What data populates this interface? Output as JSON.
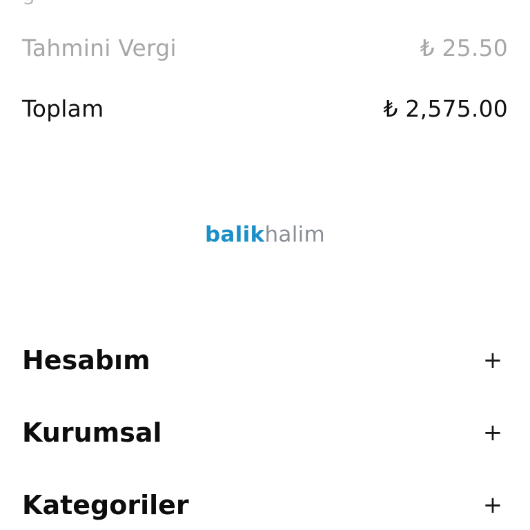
{
  "summary": {
    "tax_label": "Tahmini Vergi",
    "tax_value": "₺ 25.50",
    "total_label": "Toplam",
    "total_value": "₺ 2,575.00"
  },
  "brand": {
    "logo_part1": "balik",
    "logo_part2": "halim",
    "colors": {
      "primary": "#1b8fc8",
      "secondary": "#8a8f96"
    }
  },
  "footer_menu": {
    "sections": [
      {
        "label": "Hesabım",
        "toggle": "+"
      },
      {
        "label": "Kurumsal",
        "toggle": "+"
      },
      {
        "label": "Kategoriler",
        "toggle": "+"
      }
    ]
  }
}
